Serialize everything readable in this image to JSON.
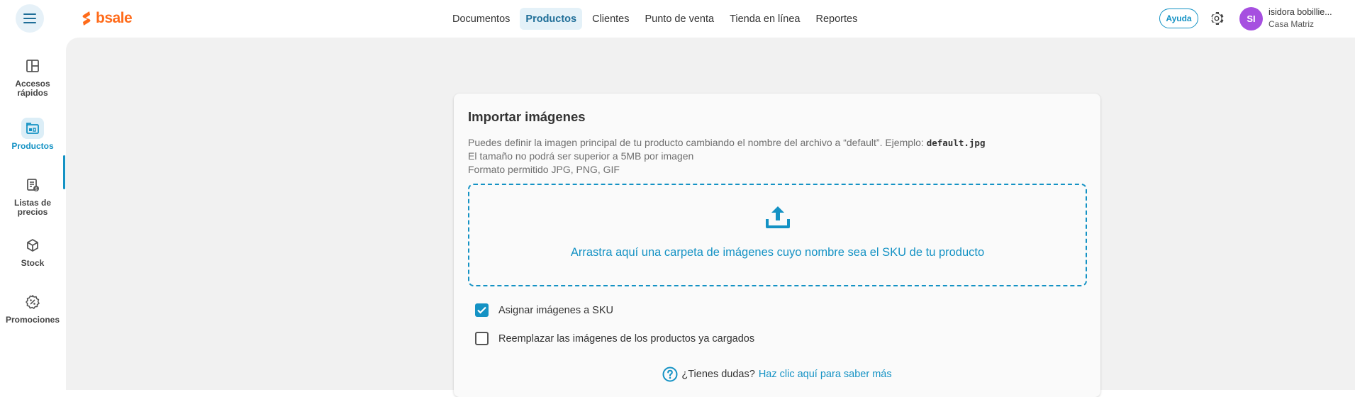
{
  "header": {
    "logo_text": "bsale",
    "nav": [
      {
        "label": "Documentos",
        "active": false
      },
      {
        "label": "Productos",
        "active": true
      },
      {
        "label": "Clientes",
        "active": false
      },
      {
        "label": "Punto de venta",
        "active": false
      },
      {
        "label": "Tienda en línea",
        "active": false
      },
      {
        "label": "Reportes",
        "active": false
      }
    ],
    "help_label": "Ayuda",
    "user": {
      "initials": "SI",
      "name": "isidora bobillie...",
      "branch": "Casa Matriz"
    }
  },
  "sidebar": {
    "items": [
      {
        "label_1": "Accesos",
        "label_2": "rápidos",
        "icon": "layout-icon"
      },
      {
        "label_1": "Productos",
        "label_2": "",
        "icon": "products-icon",
        "active": true
      },
      {
        "label_1": "Listas de",
        "label_2": "precios",
        "icon": "price-list-icon"
      },
      {
        "label_1": "Stock",
        "label_2": "",
        "icon": "cube-icon"
      },
      {
        "label_1": "Promociones",
        "label_2": "",
        "icon": "discount-icon"
      }
    ]
  },
  "import": {
    "title": "Importar imágenes",
    "desc_1": "Puedes definir la imagen principal de tu producto cambiando el nombre del archivo a “default”. Ejemplo:",
    "desc_1_code": "default.jpg",
    "desc_2": "El tamaño no podrá ser superior a 5MB por imagen",
    "desc_3": "Formato permitido JPG, PNG, GIF",
    "dropzone_text": "Arrastra aquí una carpeta de imágenes cuyo nombre sea el SKU de tu producto",
    "checkbox_1": {
      "label": "Asignar imágenes a SKU",
      "checked": true
    },
    "checkbox_2": {
      "label": "Reemplazar las imágenes de los productos ya cargados",
      "checked": false
    },
    "help_question": "¿Tienes dudas?",
    "help_link": "Haz clic aquí para saber más"
  },
  "colors": {
    "accent": "#1492c4",
    "brand": "#ff6b1a",
    "avatar": "#a64fe0"
  }
}
